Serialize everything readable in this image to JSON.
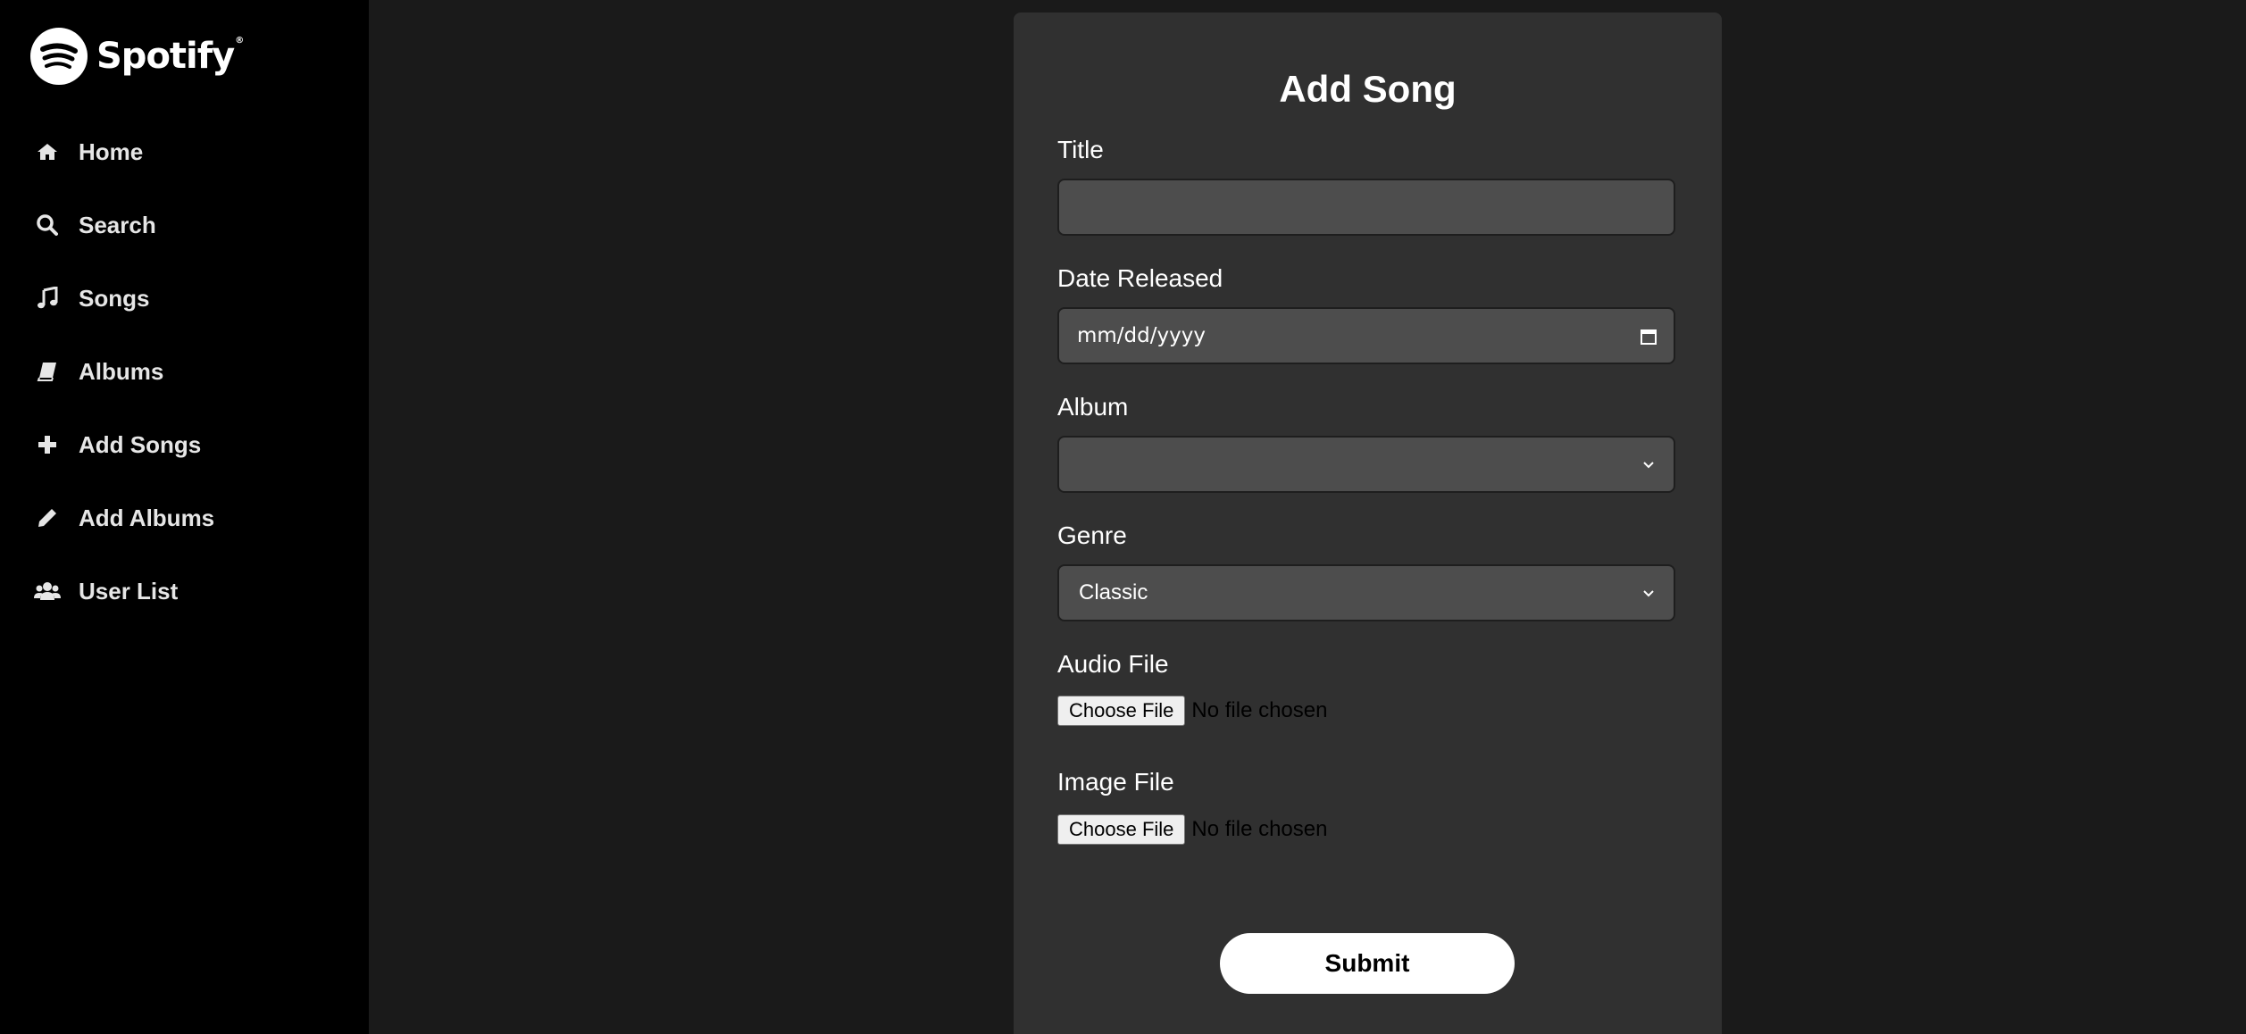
{
  "brand": {
    "name": "Spotify",
    "trademark": "®",
    "icon": "spotify-logo-icon"
  },
  "sidebar": {
    "items": [
      {
        "label": "Home",
        "icon": "home-icon"
      },
      {
        "label": "Search",
        "icon": "search-icon"
      },
      {
        "label": "Songs",
        "icon": "music-note-icon"
      },
      {
        "label": "Albums",
        "icon": "book-icon"
      },
      {
        "label": "Add Songs",
        "icon": "plus-icon"
      },
      {
        "label": "Add Albums",
        "icon": "pencil-icon"
      },
      {
        "label": "User List",
        "icon": "users-icon"
      }
    ]
  },
  "form": {
    "title": "Add Song",
    "fields": {
      "title": {
        "label": "Title",
        "value": ""
      },
      "date_released": {
        "label": "Date Released",
        "placeholder": "mm/dd/yyyy"
      },
      "album": {
        "label": "Album",
        "value": ""
      },
      "genre": {
        "label": "Genre",
        "value": "Classic"
      },
      "audio_file": {
        "label": "Audio File",
        "button": "Choose File",
        "status": "No file chosen"
      },
      "image_file": {
        "label": "Image File",
        "button": "Choose File",
        "status": "No file chosen"
      }
    },
    "submit_label": "Submit"
  },
  "colors": {
    "sidebar_bg": "#000000",
    "page_bg": "#1a1a1a",
    "card_bg": "#303030",
    "input_bg": "#4d4d4d",
    "text": "#ffffff"
  }
}
